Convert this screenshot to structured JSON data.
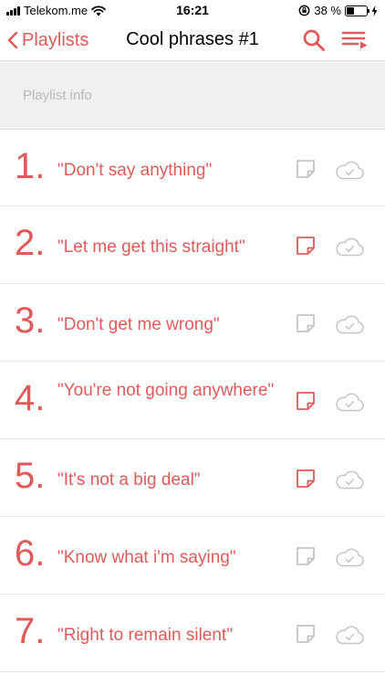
{
  "status_bar": {
    "carrier": "Telekom.me",
    "time": "16:21",
    "battery_text": "38 %",
    "battery_level": 0.38
  },
  "nav": {
    "back_label": "Playlists",
    "title": "Cool phrases #1"
  },
  "info": {
    "label": "Playlist info"
  },
  "colors": {
    "accent": "#e05a5a",
    "muted_icon": "#c4c4c4"
  },
  "rows": [
    {
      "number": "1.",
      "phrase": "\"Don't say anything\"",
      "note_active": false,
      "cloud_icon": "cloud-check-icon"
    },
    {
      "number": "2.",
      "phrase": "\"Let me get this straight\"",
      "note_active": true,
      "cloud_icon": "cloud-check-icon"
    },
    {
      "number": "3.",
      "phrase": "\"Don't get me wrong\"",
      "note_active": false,
      "cloud_icon": "cloud-check-icon"
    },
    {
      "number": "4.",
      "phrase": "\"You're not going anywhere\"",
      "note_active": true,
      "cloud_icon": "cloud-check-icon"
    },
    {
      "number": "5.",
      "phrase": "\"It's not a big deal\"",
      "note_active": true,
      "cloud_icon": "cloud-check-icon"
    },
    {
      "number": "6.",
      "phrase": "\"Know what i'm saying\"",
      "note_active": false,
      "cloud_icon": "cloud-check-icon"
    },
    {
      "number": "7.",
      "phrase": "\"Right to remain silent\"",
      "note_active": false,
      "cloud_icon": "cloud-check-icon"
    }
  ]
}
